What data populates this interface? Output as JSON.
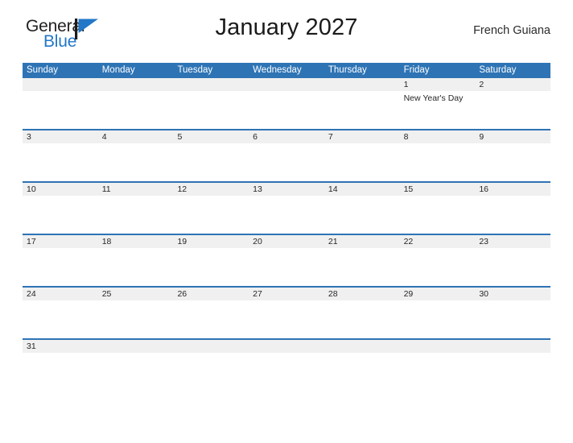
{
  "branding": {
    "logo_text_primary": "General",
    "logo_text_secondary": "Blue",
    "flag_icon": "blue-flag-icon"
  },
  "header": {
    "title": "January 2027",
    "region": "French Guiana"
  },
  "colors": {
    "header_blue": "#2E74B5",
    "date_band_gray": "#F0F0F0",
    "logo_blue": "#2277C8",
    "text_dark": "#262626"
  },
  "calendar": {
    "month": "January",
    "year": "2027",
    "weekday_headers": [
      "Sunday",
      "Monday",
      "Tuesday",
      "Wednesday",
      "Thursday",
      "Friday",
      "Saturday"
    ],
    "weeks": [
      {
        "dates": [
          "",
          "",
          "",
          "",
          "",
          "1",
          "2"
        ],
        "events": [
          [],
          [],
          [],
          [],
          [],
          [
            "New Year's Day"
          ],
          []
        ]
      },
      {
        "dates": [
          "3",
          "4",
          "5",
          "6",
          "7",
          "8",
          "9"
        ],
        "events": [
          [],
          [],
          [],
          [],
          [],
          [],
          []
        ]
      },
      {
        "dates": [
          "10",
          "11",
          "12",
          "13",
          "14",
          "15",
          "16"
        ],
        "events": [
          [],
          [],
          [],
          [],
          [],
          [],
          []
        ]
      },
      {
        "dates": [
          "17",
          "18",
          "19",
          "20",
          "21",
          "22",
          "23"
        ],
        "events": [
          [],
          [],
          [],
          [],
          [],
          [],
          []
        ]
      },
      {
        "dates": [
          "24",
          "25",
          "26",
          "27",
          "28",
          "29",
          "30"
        ],
        "events": [
          [],
          [],
          [],
          [],
          [],
          [],
          []
        ]
      },
      {
        "dates": [
          "31",
          "",
          "",
          "",
          "",
          "",
          ""
        ],
        "events": [
          [],
          [],
          [],
          [],
          [],
          [],
          []
        ]
      }
    ]
  }
}
